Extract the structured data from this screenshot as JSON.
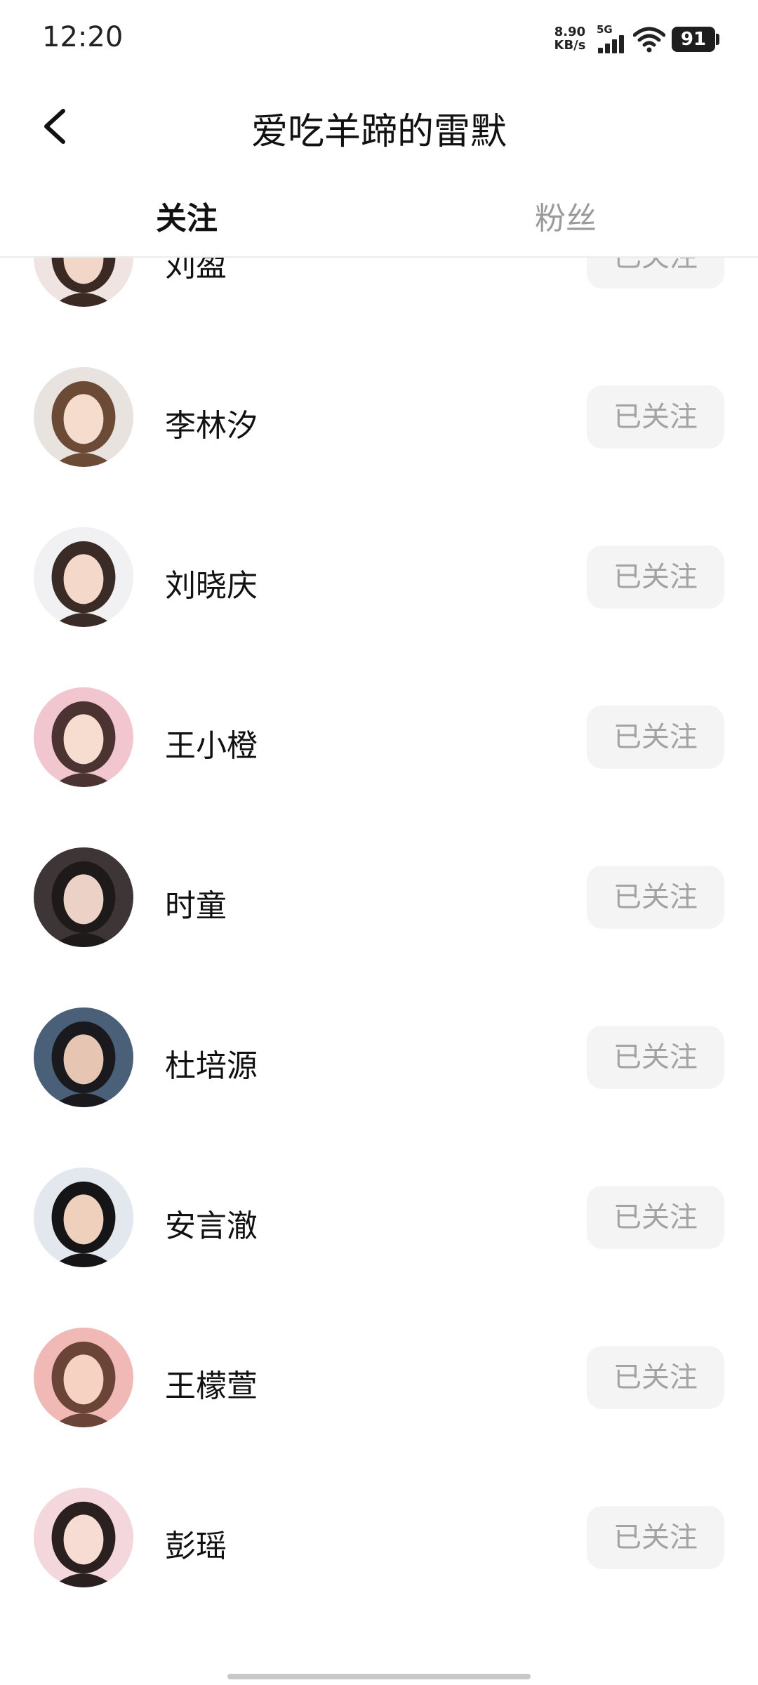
{
  "status_bar": {
    "time": "12:20",
    "net_speed_value": "8.90",
    "net_speed_unit": "KB/s",
    "network_type": "5G",
    "battery": "91",
    "icons": [
      "signal-icon",
      "wifi-icon",
      "battery-icon"
    ]
  },
  "header": {
    "title": "爱吃羊蹄的雷默",
    "back_icon": "chevron-left-icon"
  },
  "tabs": [
    {
      "label": "关注",
      "active": true
    },
    {
      "label": "粉丝",
      "active": false
    }
  ],
  "follow_list": [
    {
      "name": "刘盈",
      "button": "已关注",
      "avatar_colors": [
        "#efe4e2",
        "#3b2a24",
        "#f2d6c8"
      ]
    },
    {
      "name": "李林汐",
      "button": "已关注",
      "avatar_colors": [
        "#e9e3df",
        "#6b4a36",
        "#f5dccd"
      ]
    },
    {
      "name": "刘晓庆",
      "button": "已关注",
      "avatar_colors": [
        "#f1f1f3",
        "#3a2b26",
        "#f4d8c9"
      ]
    },
    {
      "name": "王小橙",
      "button": "已关注",
      "avatar_colors": [
        "#f2c6cf",
        "#4a3330",
        "#f7dcd0"
      ]
    },
    {
      "name": "时童",
      "button": "已关注",
      "avatar_colors": [
        "#3d3536",
        "#1f1a1a",
        "#ecd2c6"
      ]
    },
    {
      "name": "杜培源",
      "button": "已关注",
      "avatar_colors": [
        "#4a5f78",
        "#1a1a1e",
        "#e6c6b2"
      ]
    },
    {
      "name": "安言澈",
      "button": "已关注",
      "avatar_colors": [
        "#e3e8ee",
        "#151517",
        "#efd0bd"
      ]
    },
    {
      "name": "王檬萱",
      "button": "已关注",
      "avatar_colors": [
        "#f1b9b6",
        "#6a4537",
        "#f5d2c2"
      ]
    },
    {
      "name": "彭瑶",
      "button": "已关注",
      "avatar_colors": [
        "#f4d7dd",
        "#2a2020",
        "#f6dcd2"
      ]
    }
  ]
}
